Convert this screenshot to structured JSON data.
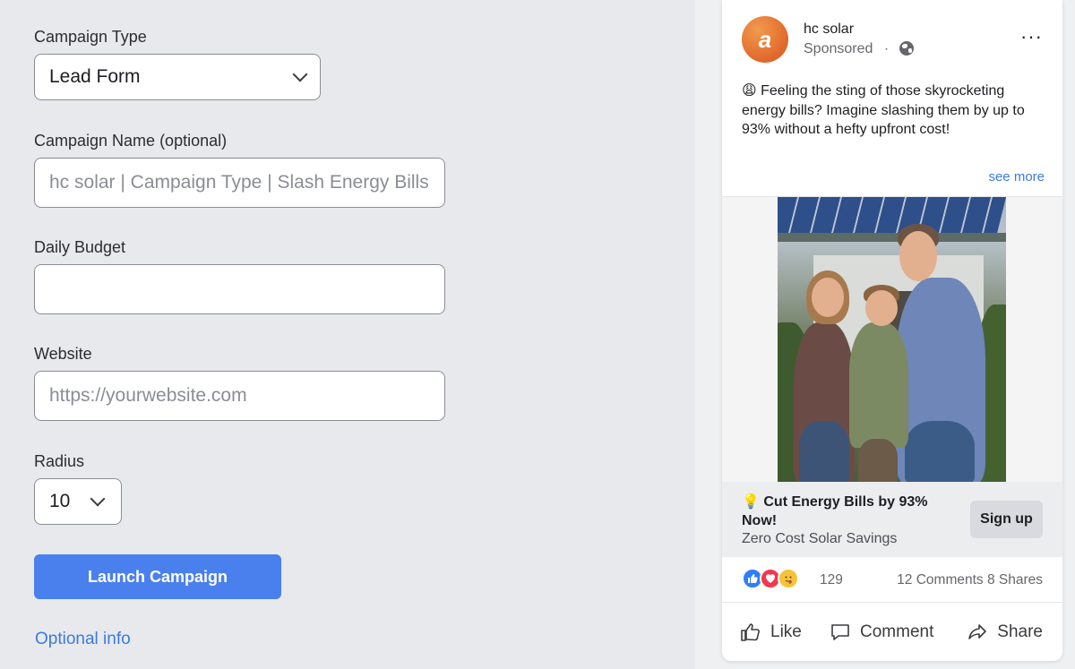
{
  "form": {
    "campaign_type": {
      "label": "Campaign Type",
      "value": "Lead Form"
    },
    "campaign_name": {
      "label": "Campaign Name (optional)",
      "placeholder": "hc solar | Campaign Type | Slash Energy Bills"
    },
    "daily_budget": {
      "label": "Daily Budget",
      "value": ""
    },
    "website": {
      "label": "Website",
      "placeholder": "https://yourwebsite.com"
    },
    "radius": {
      "label": "Radius",
      "value": "10"
    },
    "launch_label": "Launch Campaign",
    "optional_info_label": "Optional info"
  },
  "ad_preview": {
    "avatar_letter": "a",
    "page_name": "hc solar",
    "sponsored": "Sponsored",
    "sponsored_sep": "·",
    "more_icon": "···",
    "body_text": "😩 Feeling the sting of those skyrocketing energy bills? Imagine slashing them by up to 93% without a hefty upfront cost!",
    "see_more": "see more",
    "cta_title": "💡 Cut Energy Bills by 93% Now!",
    "cta_subtitle": "Zero Cost Solar Savings",
    "cta_button": "Sign up",
    "reaction_count": "129",
    "comments_shares": "12 Comments 8 Shares",
    "actions": {
      "like": "Like",
      "comment": "Comment",
      "share": "Share"
    }
  },
  "colors": {
    "primary_button": "#4a80ee",
    "link": "#3b7bdc",
    "brand_orange": "#e0682a"
  }
}
